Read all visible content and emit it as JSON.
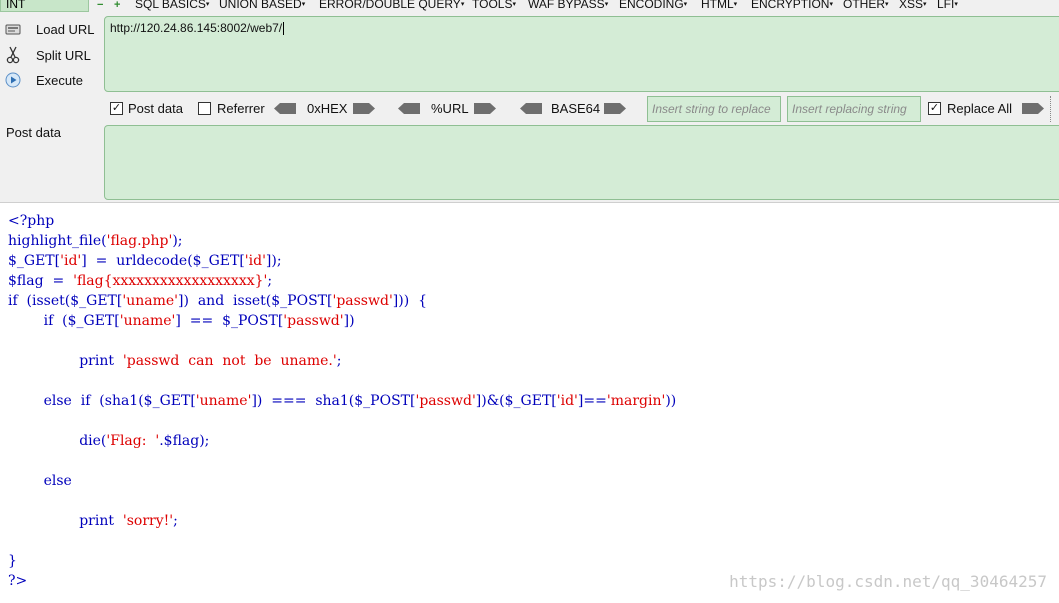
{
  "toolbar": {
    "select_value": "INT",
    "menu": [
      "SQL BASICS",
      "UNION BASED",
      "ERROR/DOUBLE QUERY",
      "TOOLS",
      "WAF BYPASS",
      "ENCODING",
      "HTML",
      "ENCRYPTION",
      "OTHER",
      "XSS",
      "LFI"
    ]
  },
  "side": {
    "load_url": "Load URL",
    "split_url": "Split URL",
    "execute": "Execute"
  },
  "url_value": "http://120.24.86.145:8002/web7/",
  "options": {
    "post_data_label": "Post data",
    "referrer_label": "Referrer",
    "hex_label": "0xHEX",
    "url_label": "%URL",
    "base64_label": "BASE64",
    "insert_placeholder": "Insert string to replace",
    "replacing_placeholder": "Insert replacing string",
    "replace_all_label": "Replace All",
    "post_data_checked": true,
    "referrer_checked": false,
    "replace_all_checked": true
  },
  "post_label": "Post data",
  "code_lines": [
    "<?php",
    "highlight_file('flag.php');",
    "$_GET['id']  =  urldecode($_GET['id']);",
    "$flag  =  'flag{xxxxxxxxxxxxxxxxxx}';",
    "if  (isset($_GET['uname'])  and  isset($_POST['passwd']))  {",
    "        if  ($_GET['uname']  ==  $_POST['passwd'])",
    "",
    "                print  'passwd  can  not  be  uname.';",
    "",
    "        else  if  (sha1($_GET['uname'])  ===  sha1($_POST['passwd'])&($_GET['id']=='margin'))",
    "",
    "                die('Flag:  '.$flag);",
    "",
    "        else",
    "",
    "                print  'sorry!';",
    "",
    "}",
    "?>"
  ],
  "watermark": "https://blog.csdn.net/qq_30464257",
  "colors": {
    "field_bg": "#d4ecd6",
    "field_border": "#8fbf93",
    "code_default": "#0000bb",
    "code_string": "#dd0000"
  }
}
